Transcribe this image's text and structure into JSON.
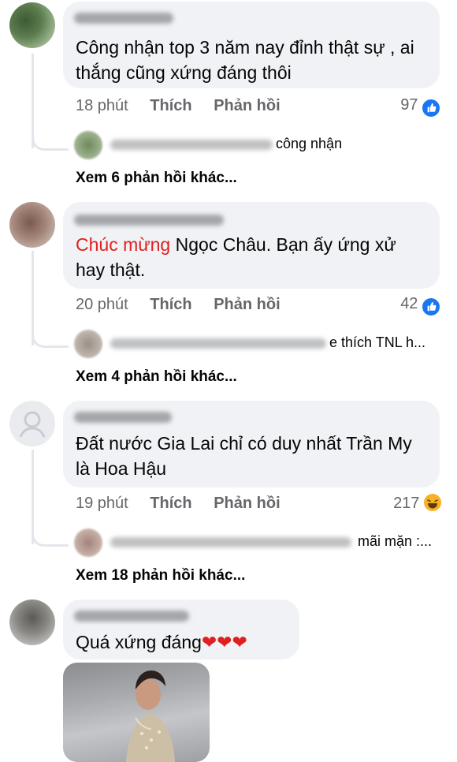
{
  "comments": [
    {
      "author": "Hương Annie",
      "text": "Công nhận top 3 năm nay đỉnh thật sự , ai thắng cũng xứng đáng thôi",
      "time": "18 phút",
      "like_label": "Thích",
      "reply_label": "Phản hồi",
      "reaction_count": "97",
      "reaction_icon": "like-icon",
      "reply_preview": "công nhận",
      "more_replies": "Xem 6 phản hồi khác..."
    },
    {
      "author": "Phạm Minh Phương",
      "text_highlight": "Chúc mừng",
      "text": " Ngọc Châu. Bạn ấy ứng xử hay thật.",
      "time": "20 phút",
      "like_label": "Thích",
      "reply_label": "Phản hồi",
      "reaction_count": "42",
      "reaction_icon": "like-icon",
      "reply_preview": "e thích TNL h...",
      "more_replies": "Xem 4 phản hồi khác..."
    },
    {
      "author": "DA THUA ĐỎ",
      "text": "Đất nước Gia Lai chỉ có duy nhất Trần My là Hoa Hậu",
      "time": "19 phút",
      "like_label": "Thích",
      "reply_label": "Phản hồi",
      "reaction_count": "217",
      "reaction_icon": "haha-icon",
      "reply_preview": "mãi mặn :...",
      "more_replies": "Xem 18 phản hồi khác..."
    },
    {
      "author": "LONG TÓC DÀI",
      "text": "Quá xứng đáng",
      "emoji": "❤❤❤"
    }
  ],
  "colors": {
    "highlight": "#e02020",
    "like_blue": "#1877f2",
    "meta_gray": "#65676b",
    "bubble_bg": "#f0f2f5"
  }
}
